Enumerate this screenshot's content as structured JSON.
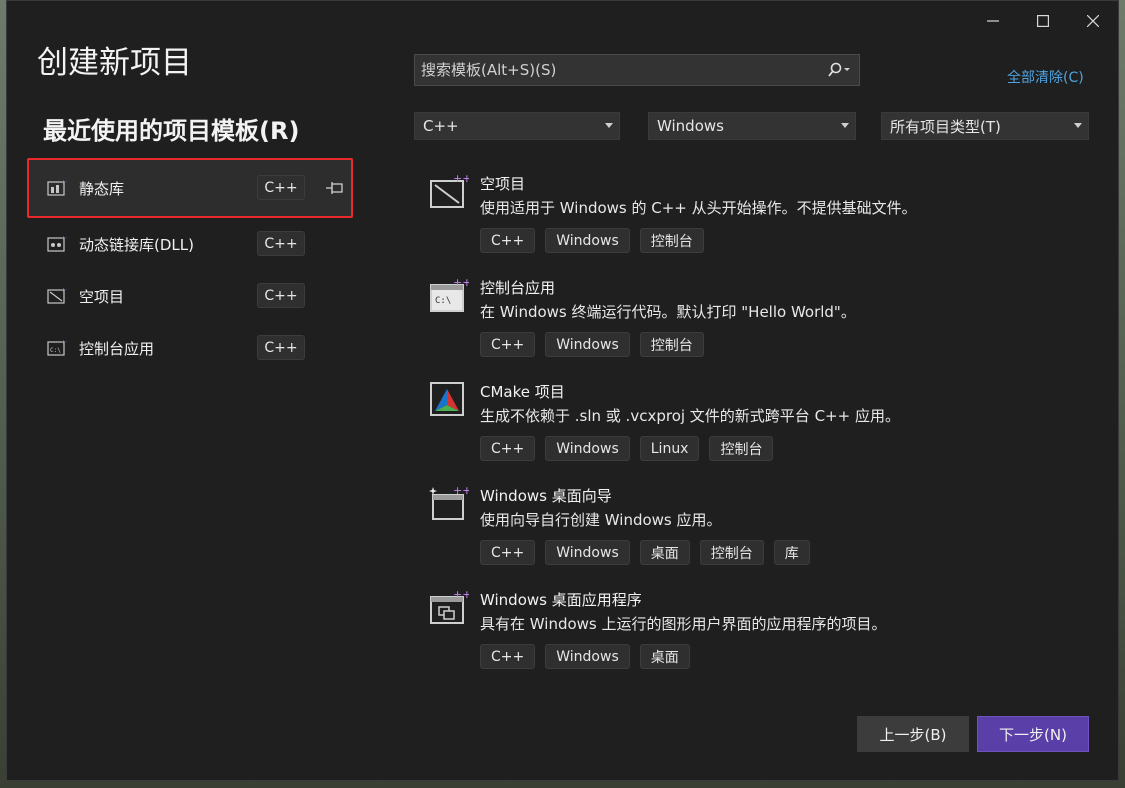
{
  "window": {
    "title": "创建新项目",
    "controls": [
      "minimize-icon",
      "maximize-icon",
      "close-icon"
    ]
  },
  "recent": {
    "title": "最近使用的项目模板(R)",
    "items": [
      {
        "label": "静态库",
        "tag": "C++",
        "icon": "static-library-icon",
        "selected": true,
        "pinned": true
      },
      {
        "label": "动态链接库(DLL)",
        "tag": "C++",
        "icon": "dll-icon"
      },
      {
        "label": "空项目",
        "tag": "C++",
        "icon": "empty-project-icon"
      },
      {
        "label": "控制台应用",
        "tag": "C++",
        "icon": "console-app-icon"
      }
    ]
  },
  "search": {
    "placeholder": "搜索模板(Alt+S)(S)",
    "clear_all": "全部清除(C)"
  },
  "filters": {
    "language": "C++",
    "platform": "Windows",
    "project_type": "所有项目类型(T)"
  },
  "templates": [
    {
      "name": "空项目",
      "description": "使用适用于 Windows 的 C++ 从头开始操作。不提供基础文件。",
      "tags": [
        "C++",
        "Windows",
        "控制台"
      ],
      "icon": "empty-project-icon"
    },
    {
      "name": "控制台应用",
      "description": "在 Windows 终端运行代码。默认打印 \"Hello World\"。",
      "tags": [
        "C++",
        "Windows",
        "控制台"
      ],
      "icon": "console-app-icon"
    },
    {
      "name": "CMake 项目",
      "description": "生成不依赖于 .sln 或 .vcxproj 文件的新式跨平台 C++ 应用。",
      "tags": [
        "C++",
        "Windows",
        "Linux",
        "控制台"
      ],
      "icon": "cmake-icon"
    },
    {
      "name": "Windows 桌面向导",
      "description": "使用向导自行创建 Windows 应用。",
      "tags": [
        "C++",
        "Windows",
        "桌面",
        "控制台",
        "库"
      ],
      "icon": "desktop-wizard-icon"
    },
    {
      "name": "Windows 桌面应用程序",
      "description": "具有在 Windows 上运行的图形用户界面的应用程序的项目。",
      "tags": [
        "C++",
        "Windows",
        "桌面"
      ],
      "icon": "desktop-app-icon"
    }
  ],
  "buttons": {
    "prev": "上一步(B)",
    "next": "下一步(N)"
  },
  "colors": {
    "accent": "#5b3fa8",
    "link": "#4ea3e0",
    "highlight": "#e8292b"
  }
}
